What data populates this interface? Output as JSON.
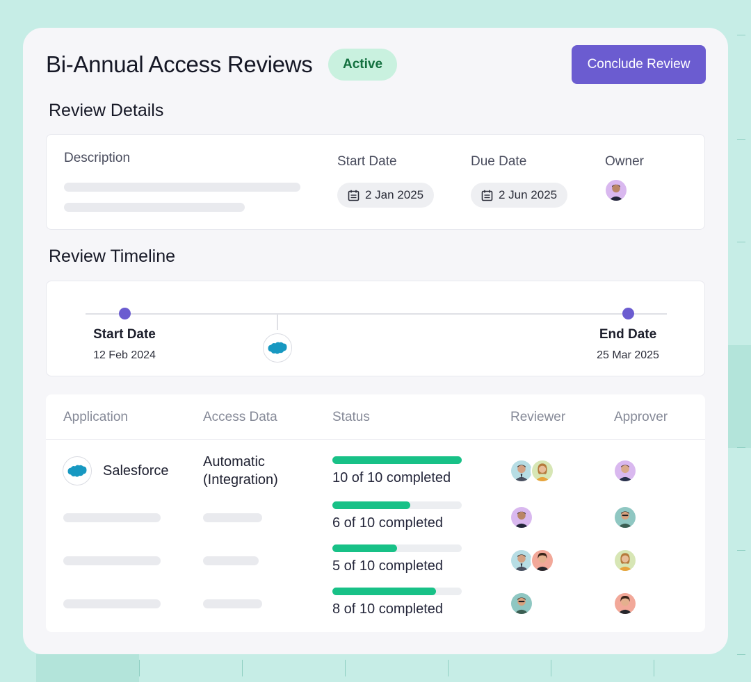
{
  "header": {
    "title": "Bi-Annual Access Reviews",
    "status_badge": "Active",
    "primary_action": "Conclude Review"
  },
  "details": {
    "section_title": "Review Details",
    "description_label": "Description",
    "start_date_label": "Start Date",
    "start_date": "2 Jan 2025",
    "due_date_label": "Due Date",
    "due_date": "2 Jun 2025",
    "owner_label": "Owner",
    "calendar_icon": "calendar-icon"
  },
  "timeline": {
    "section_title": "Review Timeline",
    "start_label": "Start Date",
    "start_date": "12 Feb 2024",
    "end_label": "End Date",
    "end_date": "25 Mar 2025",
    "milestone_logo": "salesforce"
  },
  "table": {
    "columns": [
      "Application",
      "Access Data",
      "Status",
      "Reviewer",
      "Approver"
    ],
    "rows": [
      {
        "application": "Salesforce",
        "access_data_line1": "Automatic",
        "access_data_line2": "(Integration)",
        "completed": 10,
        "total": 10,
        "status": "10 of 10 completed",
        "reviewers": 2,
        "approvers": 1
      },
      {
        "application": "",
        "access_data_line1": "",
        "access_data_line2": "",
        "completed": 6,
        "total": 10,
        "status": "6 of 10 completed",
        "reviewers": 1,
        "approvers": 1
      },
      {
        "application": "",
        "access_data_line1": "",
        "access_data_line2": "",
        "completed": 5,
        "total": 10,
        "status": "5 of 10 completed",
        "reviewers": 2,
        "approvers": 1
      },
      {
        "application": "",
        "access_data_line1": "",
        "access_data_line2": "",
        "completed": 8,
        "total": 10,
        "status": "8 of 10 completed",
        "reviewers": 1,
        "approvers": 1
      }
    ]
  },
  "colors": {
    "accent": "#6b5cd0",
    "progress": "#18c187",
    "badge_bg": "#c9f1df",
    "badge_text": "#13703f",
    "salesforce": "#1798c1"
  }
}
